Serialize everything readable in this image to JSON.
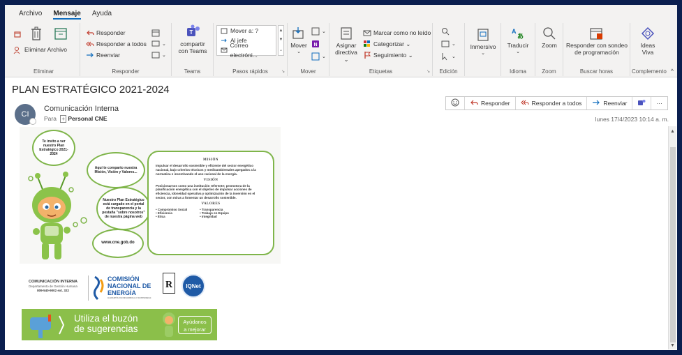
{
  "tabs": [
    "Archivo",
    "Mensaje",
    "Ayuda"
  ],
  "ribbon": {
    "groups": {
      "eliminar": {
        "label": "Eliminar",
        "eliminar_archivo": "Eliminar Archivo"
      },
      "responder": {
        "label": "Responder",
        "responder": "Responder",
        "responder_todos": "Responder a todos",
        "reenviar": "Reenviar"
      },
      "teams": {
        "label": "Teams",
        "compartir": "compartir",
        "con_teams": "con Teams"
      },
      "pasos": {
        "label": "Pasos rápidos",
        "items": [
          "Mover a: ?",
          "Al jefe",
          "Correo electróni..."
        ]
      },
      "mover": {
        "label": "Mover",
        "mover": "Mover"
      },
      "etiquetas": {
        "label": "Etiquetas",
        "asignar": "Asignar",
        "directiva": "directiva",
        "marcar": "Marcar como no leído",
        "categorizar": "Categorizar",
        "seguimiento": "Seguimiento"
      },
      "edicion": {
        "label": "Edición"
      },
      "inmersivo": {
        "label": "Inmersivo"
      },
      "idioma": {
        "label": "Idioma",
        "traducir": "Traducir"
      },
      "zoom": {
        "label": "Zoom",
        "zoom": "Zoom"
      },
      "buscar": {
        "label": "Buscar horas",
        "responder_sondeo": "Responder con sondeo",
        "de_programacion": "de programación"
      },
      "complemento": {
        "label": "Complemento",
        "ideas": "Ideas",
        "viva": "Viva"
      }
    }
  },
  "message": {
    "subject": "PLAN ESTRATÉGICO 2021-2024",
    "avatar_initials": "CI",
    "sender": "Comunicación Interna",
    "to_label": "Para",
    "to_value": "Personal CNE",
    "date": "lunes 17/4/2023 10:14 a. m.",
    "actions": {
      "responder": "Responder",
      "responder_todos": "Responder a todos",
      "reenviar": "Reenviar"
    }
  },
  "banner": {
    "bubble1": "Te invito a ver nuestro Plan Estratégico 2021-2024",
    "bubble2": "Aquí te comparto nuestra Misión, Visión y Valores...",
    "bubble3": "Nuestro Plan Estratégico está cargado en el portal de transparencia y la pestaña \"sobre nosotros\" de nuestra página web",
    "url": "www.cne.gob.do",
    "mision_title": "MISIÓN",
    "mision_text": "Impulsar el desarrollo sostenible y eficiente del sector energético nacional, bajo criterios técnicos y medioambientales apegados a la normativa e incentivando el uso racional de la energía.",
    "vision_title": "VISIÓN",
    "vision_text": "Posicionarnos como una institución referente; promotora de la planificación energética con el objetivo de impulsar acciones de eficiencia, idoneidad operativa y optimización de la inversión en el sector, con miras a fomentar un desarrollo sostenible.",
    "valores_title": "VALORES",
    "valores_left": [
      "• Compromiso Social",
      "• Eficiencia",
      "• Ética"
    ],
    "valores_right": [
      "• Transparencia",
      "• Trabajo en Equipo",
      "• Integridad"
    ]
  },
  "footer": {
    "ci_title": "COMUNICACIÓN INTERNA",
    "ci_dept": "Departamento de Gestión Humana",
    "ci_phone": "809-540-9002 ext. 322",
    "cne_1": "COMISIÓN",
    "cne_2": "NACIONAL DE",
    "cne_3": "ENERGÍA",
    "cne_sub": "GARANTÍA DE DESARROLLO SOSTENIBLE",
    "iqnet": "IQNet",
    "sugg_line1": "Utiliza el buzón",
    "sugg_line2": "de sugerencias",
    "sugg_btn1": "Ayúdanos",
    "sugg_btn2": "a mejorar"
  }
}
